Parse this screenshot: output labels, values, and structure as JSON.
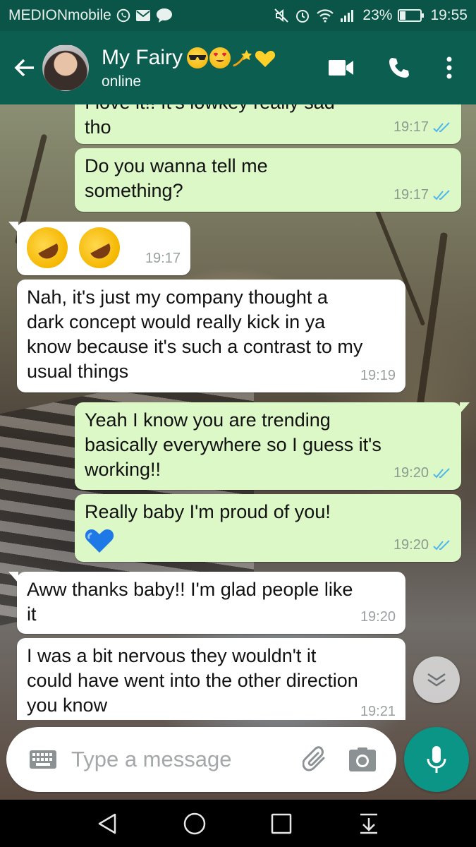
{
  "status_bar": {
    "carrier": "MEDIONmobile",
    "left_icons": [
      "whatsapp-icon",
      "mail-icon",
      "talk-icon"
    ],
    "talk_badge": "TALK",
    "right_icons": [
      "mute-icon",
      "alarm-icon",
      "wifi-icon",
      "signal-icon",
      "battery-icon"
    ],
    "battery": "23%",
    "time": "19:55"
  },
  "header": {
    "contact_name": "My Fairy",
    "name_emojis": [
      "sunglasses-emoji",
      "heart-eyes-emoji",
      "dizzy-emoji",
      "yellow-heart-emoji"
    ],
    "presence": "online",
    "actions": [
      "video-call-icon",
      "voice-call-icon",
      "more-options-icon"
    ]
  },
  "messages": [
    {
      "direction": "out",
      "text": "tho",
      "time": "19:17",
      "status": "read",
      "cut_text": "I love it!! It's lowkey really sad"
    },
    {
      "direction": "out",
      "text": "Do you wanna tell me\nsomething?",
      "time": "19:17",
      "status": "read"
    },
    {
      "direction": "in",
      "emoji": [
        "rolling-on-floor-laughing-emoji",
        "rolling-on-floor-laughing-emoji"
      ],
      "time": "19:17"
    },
    {
      "direction": "in",
      "text": "Nah, it's just my company thought a\ndark concept would really kick in ya\nknow because it's such a contrast to my\nusual things",
      "time": "19:19"
    },
    {
      "direction": "out",
      "text": "Yeah I know you are trending\nbasically everywhere so I guess it's\nworking!!",
      "time": "19:20",
      "status": "read"
    },
    {
      "direction": "out",
      "text": "Really baby I'm proud of you!",
      "emoji": [
        "blue-heart-emoji"
      ],
      "time": "19:20",
      "status": "read"
    },
    {
      "direction": "in",
      "text": "Aww thanks baby!! I'm glad people like\nit",
      "time": "19:20"
    },
    {
      "direction": "in",
      "text": "I was a bit nervous they wouldn't it\ncould have went into the other direction\nyou know",
      "time": "19:21"
    }
  ],
  "composer": {
    "placeholder": "Type a message",
    "icons": [
      "keyboard-icon",
      "attach-icon",
      "camera-icon",
      "mic-icon"
    ]
  },
  "colors": {
    "header": "#0b5e50",
    "status_bar": "#0a5547",
    "outgoing_bubble": "#dcf8c6",
    "incoming_bubble": "#ffffff",
    "read_tick": "#4fb6ec",
    "mic_button": "#0b9587"
  },
  "nav_bar": [
    "back-icon",
    "home-icon",
    "recents-icon",
    "notification-pull-icon"
  ]
}
